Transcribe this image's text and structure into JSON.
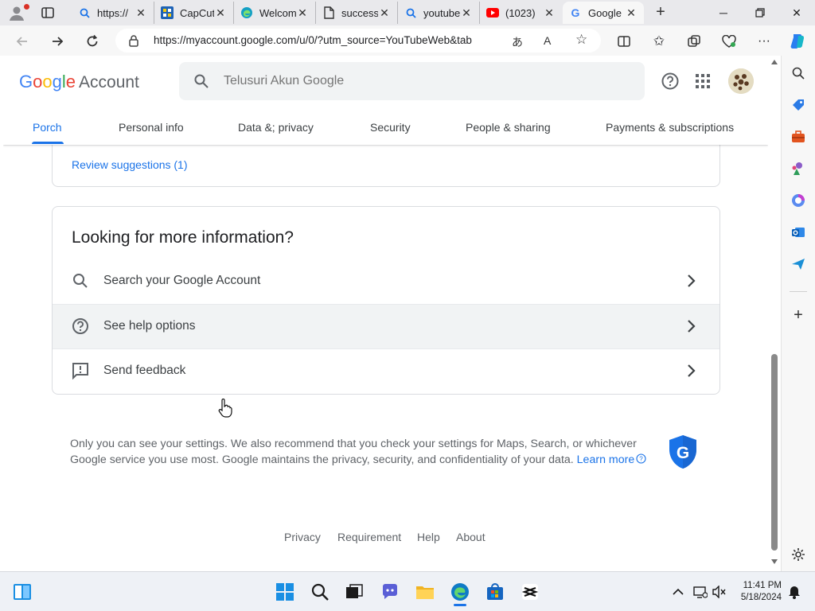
{
  "browser": {
    "tabs": [
      {
        "title": "https://",
        "icon": "search-favicon"
      },
      {
        "title": "CapCut",
        "icon": "capcut-favicon"
      },
      {
        "title": "Welcome",
        "icon": "edge-favicon"
      },
      {
        "title": "success",
        "icon": "document-favicon"
      },
      {
        "title": "youtube",
        "icon": "search-favicon"
      },
      {
        "title": "(1023)",
        "icon": "youtube-favicon"
      },
      {
        "title": "Google",
        "icon": "google-favicon"
      }
    ],
    "url": "https://myaccount.google.com/u/0/?utm_source=YouTubeWeb&tab"
  },
  "header": {
    "logo_google": "Google",
    "logo_account": "Account",
    "search_placeholder": "Telusuri Akun Google"
  },
  "nav_tabs": [
    "Porch",
    "Personal info",
    "Data &; privacy",
    "Security",
    "People & sharing",
    "Payments & subscriptions"
  ],
  "card1": {
    "link": "Review suggestions (1)"
  },
  "card2": {
    "title": "Looking for more information?",
    "rows": [
      "Search your Google Account",
      "See help options",
      "Send feedback"
    ]
  },
  "privacy": {
    "text": "Only you can see your settings. We also recommend that you check your settings for Maps, Search, or whichever Google service you use most. Google maintains the privacy, security, and confidentiality of your data.",
    "learn_more": "Learn more"
  },
  "footer": [
    "Privacy",
    "Requirement",
    "Help",
    "About"
  ],
  "taskbar": {
    "time": "11:41 PM",
    "date": "5/18/2024"
  },
  "colors": {
    "accent": "#1a73e8",
    "google_blue": "#4285f4",
    "google_red": "#ea4335",
    "google_yellow": "#fbbc05",
    "google_green": "#34a853"
  }
}
